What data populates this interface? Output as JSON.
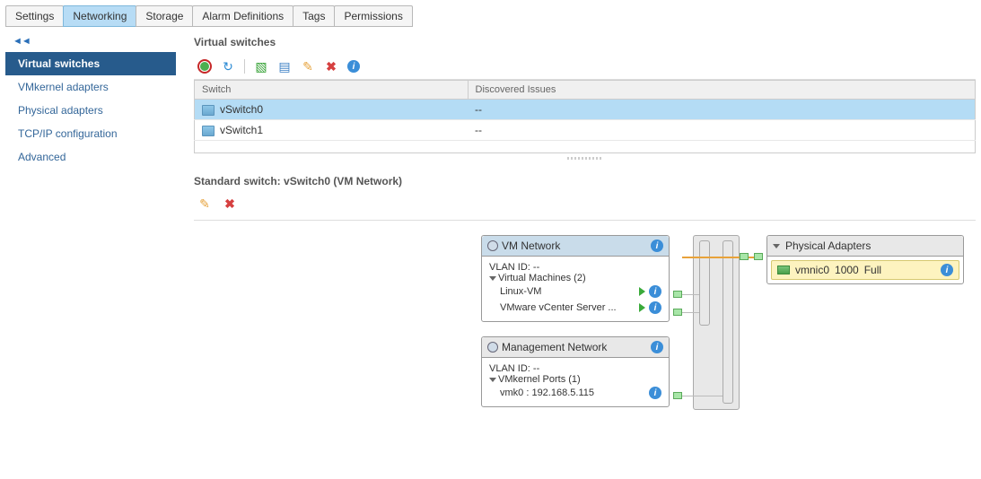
{
  "tabs": [
    "Settings",
    "Networking",
    "Storage",
    "Alarm Definitions",
    "Tags",
    "Permissions"
  ],
  "active_tab": "Networking",
  "sidebar": {
    "items": [
      "Virtual switches",
      "VMkernel adapters",
      "Physical adapters",
      "TCP/IP configuration",
      "Advanced"
    ],
    "active": "Virtual switches"
  },
  "section_title": "Virtual switches",
  "table": {
    "cols": [
      "Switch",
      "Discovered Issues"
    ],
    "rows": [
      {
        "name": "vSwitch0",
        "issues": "--",
        "selected": true
      },
      {
        "name": "vSwitch1",
        "issues": "--",
        "selected": false
      }
    ]
  },
  "detail_title": "Standard switch: vSwitch0 (VM Network)",
  "vm_network": {
    "title": "VM Network",
    "vlan": "VLAN ID: --",
    "group_label": "Virtual Machines (2)",
    "vms": [
      "Linux-VM",
      "VMware vCenter Server ..."
    ]
  },
  "mgmt_network": {
    "title": "Management Network",
    "vlan": "VLAN ID: --",
    "group_label": "VMkernel Ports (1)",
    "port": "vmk0 : 192.168.5.115"
  },
  "physical": {
    "title": "Physical Adapters",
    "nic": {
      "name": "vmnic0",
      "speed": "1000",
      "duplex": "Full"
    }
  }
}
